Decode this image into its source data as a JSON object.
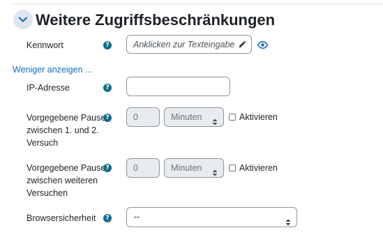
{
  "section": {
    "title": "Weitere Zugriffsbeschränkungen"
  },
  "password": {
    "label": "Kennwort",
    "placeholder": "Anklicken zur Texteingabe"
  },
  "show_less_link": "Weniger anzeigen ...",
  "ip": {
    "label": "IP-Adresse",
    "value": ""
  },
  "delay1": {
    "label_lines": [
      "Vorgegebene Pause",
      "zwischen 1. und 2.",
      "Versuch"
    ],
    "value": "0",
    "unit": "Minuten",
    "enable_label": "Aktivieren",
    "enabled": false
  },
  "delay2": {
    "label_lines": [
      "Vorgegebene Pause",
      "zwischen weiteren",
      "Versuchen"
    ],
    "value": "0",
    "unit": "Minuten",
    "enable_label": "Aktivieren",
    "enabled": false
  },
  "browser": {
    "label": "Browsersicherheit",
    "value": "--"
  },
  "help_glyph": "?",
  "icons": {
    "collapse": "chevron-down-icon",
    "edit": "pencil-icon",
    "reveal": "eye-icon",
    "help": "help-icon",
    "select_arrows": "select-arrows-icon"
  },
  "colors": {
    "link": "#0f6cbf",
    "help_icon": "#0f6e8a",
    "collapse_bg": "#dfe5f0",
    "disabled_field": "#e9ecef"
  }
}
